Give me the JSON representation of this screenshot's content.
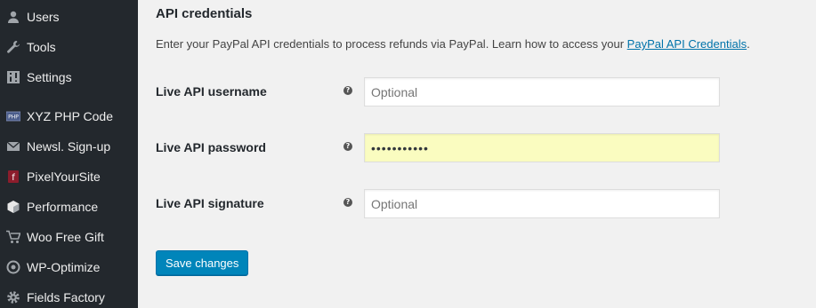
{
  "sidebar": {
    "items": [
      {
        "label": "Users",
        "icon": "users-icon"
      },
      {
        "label": "Tools",
        "icon": "wrench-icon"
      },
      {
        "label": "Settings",
        "icon": "settings-icon"
      },
      {
        "label": "XYZ PHP Code",
        "icon": "php-icon"
      },
      {
        "label": "Newsl. Sign-up",
        "icon": "envelope-icon"
      },
      {
        "label": "PixelYourSite",
        "icon": "pixelyoursite-icon"
      },
      {
        "label": "Performance",
        "icon": "performance-icon"
      },
      {
        "label": "Woo Free Gift",
        "icon": "cart-icon"
      },
      {
        "label": "WP-Optimize",
        "icon": "wp-optimize-icon"
      },
      {
        "label": "Fields Factory",
        "icon": "gear-icon"
      }
    ]
  },
  "main": {
    "section_title": "API credentials",
    "description_text": "Enter your PayPal API credentials to process refunds via PayPal. Learn how to access your ",
    "description_link": "PayPal API Credentials",
    "description_end": ".",
    "fields": [
      {
        "label": "Live API username",
        "placeholder": "Optional",
        "value": ""
      },
      {
        "label": "Live API password",
        "placeholder": "",
        "value": "•••••••••••"
      },
      {
        "label": "Live API signature",
        "placeholder": "Optional",
        "value": ""
      }
    ],
    "save_label": "Save changes"
  },
  "colors": {
    "sidebar_bg": "#23282d",
    "accent": "#0085ba",
    "link": "#0073aa",
    "autofill": "#fafcc0"
  }
}
